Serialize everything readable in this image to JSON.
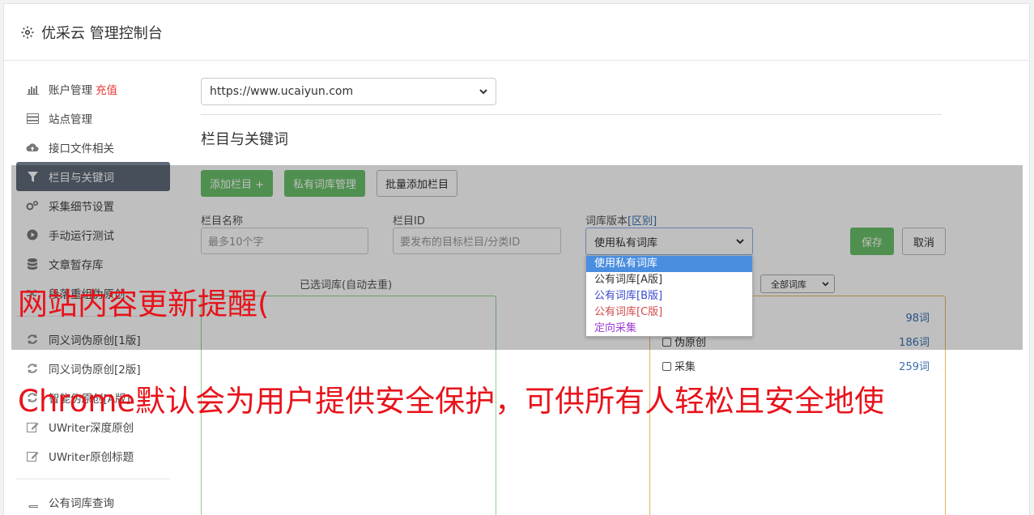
{
  "header": {
    "title": "优采云 管理控制台",
    "icon": "gear-icon"
  },
  "sidebar": {
    "items": [
      {
        "label": "账户管理",
        "badge": "充值",
        "icon": "bar-chart-icon"
      },
      {
        "label": "站点管理",
        "icon": "server-icon"
      },
      {
        "label": "接口文件相关",
        "icon": "cloud-upload-icon"
      },
      {
        "label": "栏目与关键词",
        "icon": "filter-icon",
        "active": true
      },
      {
        "label": "采集细节设置",
        "icon": "gears-icon"
      },
      {
        "label": "手动运行测试",
        "icon": "play-circle-icon"
      },
      {
        "label": "文章暂存库",
        "icon": "database-icon"
      },
      {
        "label": "段落重组伪原创",
        "icon": "random-icon"
      },
      {
        "label": "同义词伪原创[1版]",
        "icon": "refresh-icon"
      },
      {
        "label": "同义词伪原创[2版]",
        "icon": "refresh-icon"
      },
      {
        "label": "智能伪原创[A版]",
        "icon": "refresh-icon"
      },
      {
        "label": "UWriter深度原创",
        "icon": "edit-icon"
      },
      {
        "label": "UWriter原创标题",
        "icon": "edit-icon"
      },
      {
        "label": "公有词库查询",
        "icon": "book-icon"
      }
    ]
  },
  "main": {
    "site_select_value": "https://www.ucaiyun.com",
    "section_title": "栏目与关键词",
    "buttons": {
      "add_column": "添加栏目 +",
      "private_lib": "私有词库管理",
      "batch_add": "批量添加栏目"
    },
    "fields": {
      "column_name_label": "栏目名称",
      "column_name_placeholder": "最多10个字",
      "column_id_label": "栏目ID",
      "column_id_placeholder": "要发布的目标栏目/分类ID",
      "lib_version_label": "词库版本",
      "lib_version_link": "[区别]",
      "lib_version_value": "使用私有词库"
    },
    "save_label": "保存",
    "cancel_label": "取消",
    "dropdown_options": [
      {
        "label": "使用私有词库",
        "color": "#ffffff"
      },
      {
        "label": "公有词库[A版]",
        "color": "#333333"
      },
      {
        "label": "公有词库[B版]",
        "color": "#3b4ad1"
      },
      {
        "label": "公有词库[C版]",
        "color": "#d14a4a"
      },
      {
        "label": "定向采集",
        "color": "#9b3bd1"
      }
    ],
    "selected_box_label": "已选词库(自动去重)",
    "lib_filter_value": "全部词库",
    "lib_rows": [
      {
        "name": "",
        "count": "98词"
      },
      {
        "name": "伪原创",
        "count": "186词"
      },
      {
        "name": "采集",
        "count": "259词"
      }
    ]
  },
  "overlay_text": {
    "line1": "网站内容更新提醒(",
    "line2": "Chrome默认会为用户提供安全保护，可供所有人轻松且安全地使"
  }
}
